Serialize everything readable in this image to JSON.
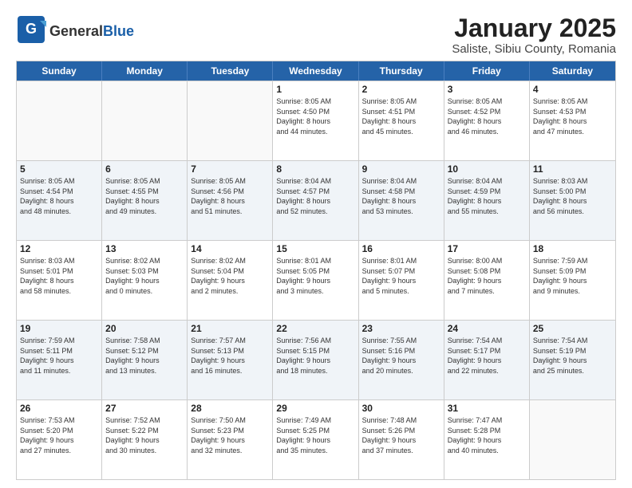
{
  "logo": {
    "general": "General",
    "blue": "Blue"
  },
  "title": "January 2025",
  "subtitle": "Saliste, Sibiu County, Romania",
  "headers": [
    "Sunday",
    "Monday",
    "Tuesday",
    "Wednesday",
    "Thursday",
    "Friday",
    "Saturday"
  ],
  "rows": [
    [
      {
        "day": "",
        "info": ""
      },
      {
        "day": "",
        "info": ""
      },
      {
        "day": "",
        "info": ""
      },
      {
        "day": "1",
        "info": "Sunrise: 8:05 AM\nSunset: 4:50 PM\nDaylight: 8 hours\nand 44 minutes."
      },
      {
        "day": "2",
        "info": "Sunrise: 8:05 AM\nSunset: 4:51 PM\nDaylight: 8 hours\nand 45 minutes."
      },
      {
        "day": "3",
        "info": "Sunrise: 8:05 AM\nSunset: 4:52 PM\nDaylight: 8 hours\nand 46 minutes."
      },
      {
        "day": "4",
        "info": "Sunrise: 8:05 AM\nSunset: 4:53 PM\nDaylight: 8 hours\nand 47 minutes."
      }
    ],
    [
      {
        "day": "5",
        "info": "Sunrise: 8:05 AM\nSunset: 4:54 PM\nDaylight: 8 hours\nand 48 minutes."
      },
      {
        "day": "6",
        "info": "Sunrise: 8:05 AM\nSunset: 4:55 PM\nDaylight: 8 hours\nand 49 minutes."
      },
      {
        "day": "7",
        "info": "Sunrise: 8:05 AM\nSunset: 4:56 PM\nDaylight: 8 hours\nand 51 minutes."
      },
      {
        "day": "8",
        "info": "Sunrise: 8:04 AM\nSunset: 4:57 PM\nDaylight: 8 hours\nand 52 minutes."
      },
      {
        "day": "9",
        "info": "Sunrise: 8:04 AM\nSunset: 4:58 PM\nDaylight: 8 hours\nand 53 minutes."
      },
      {
        "day": "10",
        "info": "Sunrise: 8:04 AM\nSunset: 4:59 PM\nDaylight: 8 hours\nand 55 minutes."
      },
      {
        "day": "11",
        "info": "Sunrise: 8:03 AM\nSunset: 5:00 PM\nDaylight: 8 hours\nand 56 minutes."
      }
    ],
    [
      {
        "day": "12",
        "info": "Sunrise: 8:03 AM\nSunset: 5:01 PM\nDaylight: 8 hours\nand 58 minutes."
      },
      {
        "day": "13",
        "info": "Sunrise: 8:02 AM\nSunset: 5:03 PM\nDaylight: 9 hours\nand 0 minutes."
      },
      {
        "day": "14",
        "info": "Sunrise: 8:02 AM\nSunset: 5:04 PM\nDaylight: 9 hours\nand 2 minutes."
      },
      {
        "day": "15",
        "info": "Sunrise: 8:01 AM\nSunset: 5:05 PM\nDaylight: 9 hours\nand 3 minutes."
      },
      {
        "day": "16",
        "info": "Sunrise: 8:01 AM\nSunset: 5:07 PM\nDaylight: 9 hours\nand 5 minutes."
      },
      {
        "day": "17",
        "info": "Sunrise: 8:00 AM\nSunset: 5:08 PM\nDaylight: 9 hours\nand 7 minutes."
      },
      {
        "day": "18",
        "info": "Sunrise: 7:59 AM\nSunset: 5:09 PM\nDaylight: 9 hours\nand 9 minutes."
      }
    ],
    [
      {
        "day": "19",
        "info": "Sunrise: 7:59 AM\nSunset: 5:11 PM\nDaylight: 9 hours\nand 11 minutes."
      },
      {
        "day": "20",
        "info": "Sunrise: 7:58 AM\nSunset: 5:12 PM\nDaylight: 9 hours\nand 13 minutes."
      },
      {
        "day": "21",
        "info": "Sunrise: 7:57 AM\nSunset: 5:13 PM\nDaylight: 9 hours\nand 16 minutes."
      },
      {
        "day": "22",
        "info": "Sunrise: 7:56 AM\nSunset: 5:15 PM\nDaylight: 9 hours\nand 18 minutes."
      },
      {
        "day": "23",
        "info": "Sunrise: 7:55 AM\nSunset: 5:16 PM\nDaylight: 9 hours\nand 20 minutes."
      },
      {
        "day": "24",
        "info": "Sunrise: 7:54 AM\nSunset: 5:17 PM\nDaylight: 9 hours\nand 22 minutes."
      },
      {
        "day": "25",
        "info": "Sunrise: 7:54 AM\nSunset: 5:19 PM\nDaylight: 9 hours\nand 25 minutes."
      }
    ],
    [
      {
        "day": "26",
        "info": "Sunrise: 7:53 AM\nSunset: 5:20 PM\nDaylight: 9 hours\nand 27 minutes."
      },
      {
        "day": "27",
        "info": "Sunrise: 7:52 AM\nSunset: 5:22 PM\nDaylight: 9 hours\nand 30 minutes."
      },
      {
        "day": "28",
        "info": "Sunrise: 7:50 AM\nSunset: 5:23 PM\nDaylight: 9 hours\nand 32 minutes."
      },
      {
        "day": "29",
        "info": "Sunrise: 7:49 AM\nSunset: 5:25 PM\nDaylight: 9 hours\nand 35 minutes."
      },
      {
        "day": "30",
        "info": "Sunrise: 7:48 AM\nSunset: 5:26 PM\nDaylight: 9 hours\nand 37 minutes."
      },
      {
        "day": "31",
        "info": "Sunrise: 7:47 AM\nSunset: 5:28 PM\nDaylight: 9 hours\nand 40 minutes."
      },
      {
        "day": "",
        "info": ""
      }
    ]
  ]
}
